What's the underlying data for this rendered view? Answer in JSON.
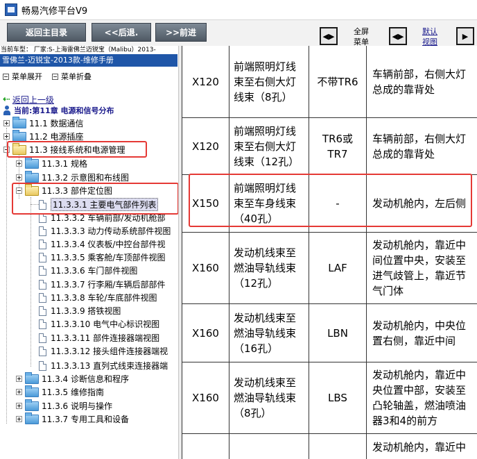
{
  "window": {
    "title": "畅易汽修平台V9"
  },
  "toolbar": {
    "back_main": "返回主目录",
    "back": "<<后退.",
    "forward": ">>前进",
    "fullscreen_label_1": "全屏",
    "fullscreen_label_2": "菜单",
    "default_view_label_1": "默认",
    "default_view_label_2": "视图"
  },
  "vehicle_line": "当前车型： 厂家:S-上海雷佛兰迈锐宝（Malibu）2013-",
  "manual_title": "雪佛兰-迈锐宝-2013款-维修手册",
  "menu_ops": {
    "expand": "菜单展开",
    "collapse": "菜单折叠"
  },
  "tree": {
    "back_up": "返回上一级",
    "current": "当前:第11章 电源和信号分布",
    "items": [
      {
        "label": "11.1 数据通信"
      },
      {
        "label": "11.2 电源插座"
      },
      {
        "label": "11.3 接线系统和电源管理"
      },
      {
        "label": "11.3.1 规格"
      },
      {
        "label": "11.3.2 示意图和布线图"
      },
      {
        "label": "11.3.3 部件定位图"
      },
      {
        "label": "11.3.3.1 主要电气部件列表"
      },
      {
        "label": "11.3.3.2 车辆前部/发动机舱部"
      },
      {
        "label": "11.3.3.3 动力传动系统部件视图"
      },
      {
        "label": "11.3.3.4 仪表板/中控台部件视"
      },
      {
        "label": "11.3.3.5 乘客舱/车顶部件视图"
      },
      {
        "label": "11.3.3.6 车门部件视图"
      },
      {
        "label": "11.3.3.7 行李厢/车辆后部部件"
      },
      {
        "label": "11.3.3.8 车轮/车底部件视图"
      },
      {
        "label": "11.3.3.9 搭铁视图"
      },
      {
        "label": "11.3.3.10 电气中心标识视图"
      },
      {
        "label": "11.3.3.11 部件连接器端视图"
      },
      {
        "label": "11.3.3.12 接头组件连接器端视"
      },
      {
        "label": "11.3.3.13 直列式线束连接器端"
      },
      {
        "label": "11.3.4 诊断信息和程序"
      },
      {
        "label": "11.3.5 维修指南"
      },
      {
        "label": "11.3.6 说明与操作"
      },
      {
        "label": "11.3.7 专用工具和设备"
      }
    ]
  },
  "table": {
    "rows": [
      {
        "code": "X120",
        "name_lines": [
          "前端照明灯线",
          "束至右侧大灯",
          "线束（8孔）"
        ],
        "option": "不带TR6",
        "location_lines": [
          "车辆前部，右侧大灯",
          "总成的靠背处"
        ]
      },
      {
        "code": "X120",
        "name_lines": [
          "前端照明灯线",
          "束至右侧大灯",
          "线束（12孔）"
        ],
        "option_lines": [
          "TR6或",
          "TR7"
        ],
        "location_lines": [
          "车辆前部，右侧大灯",
          "总成的靠背处"
        ]
      },
      {
        "code": "X150",
        "name_lines": [
          "前端照明灯线",
          "束至车身线束",
          "（40孔）"
        ],
        "option": "-",
        "location_lines": [
          "发动机舱内，左后侧"
        ]
      },
      {
        "code": "X160",
        "name_lines": [
          "发动机线束至",
          "燃油导轨线束",
          "（12孔）"
        ],
        "option": "LAF",
        "location_lines": [
          "发动机舱内，靠近中",
          "间位置中央，安装至",
          "进气歧管上，靠近节",
          "气门体"
        ]
      },
      {
        "code": "X160",
        "name_lines": [
          "发动机线束至",
          "燃油导轨线束",
          "（16孔）"
        ],
        "option": "LBN",
        "location_lines": [
          "发动机舱内，中央位",
          "置右侧，靠近中间"
        ]
      },
      {
        "code": "X160",
        "name_lines": [
          "发动机线束至",
          "燃油导轨线束",
          "（8孔）"
        ],
        "option": "LBS",
        "location_lines": [
          "发动机舱内，靠近中",
          "央位置中部，安装至",
          "凸轮轴盖，燃油喷油",
          "器3和4的前方"
        ]
      },
      {
        "location_lines": [
          "发动机舱内，靠近中"
        ]
      }
    ]
  },
  "colors": {
    "highlight_box": "#e53935",
    "manual_bar": "#1f56a8",
    "link": "#1a1a8c"
  }
}
